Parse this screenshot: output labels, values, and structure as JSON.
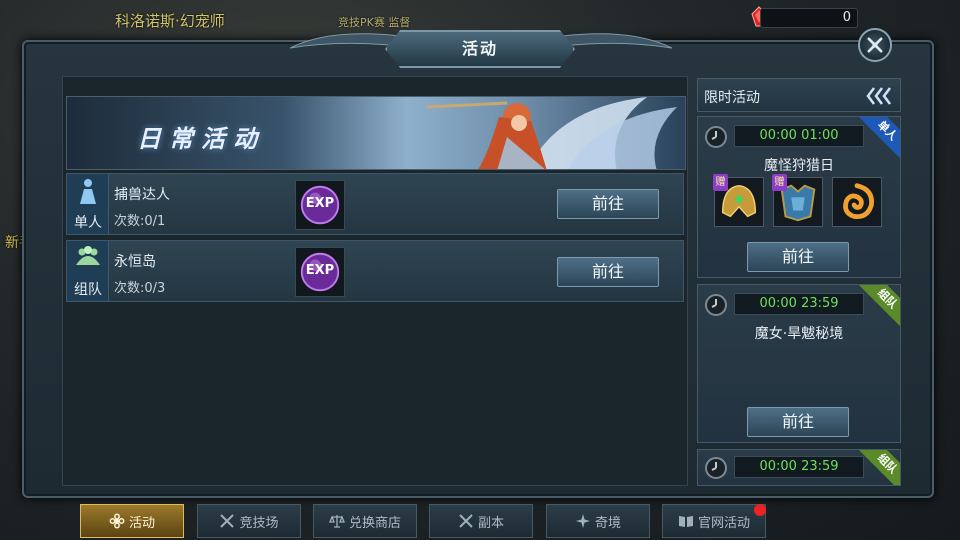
{
  "background": {
    "player_name": "科洛诺斯·幻宠师",
    "top_event": "竞技PK赛 监督",
    "side_text": "新手"
  },
  "currency": {
    "value": "0",
    "icon": "red-gem-icon"
  },
  "window": {
    "title": "活动",
    "close_icon": "close-icon"
  },
  "banner": {
    "title": "日常活动"
  },
  "daily": [
    {
      "tag": "单人",
      "tag_icon": "solo-figure-icon",
      "name": "捕兽达人",
      "count": "次数:0/1",
      "reward_icon": "exp-orb-icon",
      "reward_text": "EXP",
      "button": "前往"
    },
    {
      "tag": "组队",
      "tag_icon": "team-icon",
      "name": "永恒岛",
      "count": "次数:0/3",
      "reward_icon": "exp-orb-icon",
      "reward_text": "EXP",
      "button": "前往"
    }
  ],
  "limited": {
    "header": "限时活动",
    "collapse_icon": "triple-chevron-left-icon",
    "events": [
      {
        "time": "00:00  01:00",
        "badge": "单人",
        "name": "魔怪狩猎日",
        "button": "前往",
        "rewards": [
          {
            "icon": "gold-helmet-icon",
            "gift": "赠"
          },
          {
            "icon": "blue-armor-icon",
            "gift": "赠"
          },
          {
            "icon": "fire-swirl-icon",
            "gift": ""
          }
        ]
      },
      {
        "time": "00:00  23:59",
        "badge": "组队",
        "name": "魔女·旱魃秘境",
        "button": "前往",
        "rewards": []
      },
      {
        "time": "00:00  23:59",
        "badge": "组队",
        "name": "",
        "button": "",
        "rewards": []
      }
    ]
  },
  "tabs": [
    {
      "label": "活动",
      "icon": "flower-icon",
      "active": true
    },
    {
      "label": "竞技场",
      "icon": "crossed-swords-icon",
      "active": false
    },
    {
      "label": "兑换商店",
      "icon": "scales-icon",
      "active": false
    },
    {
      "label": "副本",
      "icon": "crossed-swords-icon",
      "active": false
    },
    {
      "label": "奇境",
      "icon": "compass-icon",
      "active": false
    },
    {
      "label": "官网活动",
      "icon": "book-icon",
      "active": false,
      "notification": true
    }
  ],
  "colors": {
    "timer_green": "#6fe05a",
    "badge_blue": "#1f59b8",
    "badge_green": "#5a8a2a",
    "active_tab_gold": "#9c7a2c",
    "notify_red": "#ee2222"
  }
}
